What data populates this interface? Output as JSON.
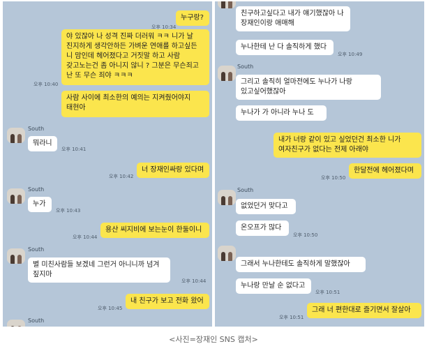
{
  "caption": "<사진=장재인 SNS 캡처>",
  "contact_name": "South",
  "colors": {
    "chat_background": "#b5c6d8",
    "my_bubble": "#fbe54d",
    "their_bubble": "#ffffff"
  },
  "left": {
    "messages": [
      {
        "from": "me",
        "text": "누구랑?",
        "time": "오후 10:34"
      },
      {
        "from": "me",
        "text": "야 있잖아 나 성격 진짜 더러워 ㅋㅋ 니가 날 진지하게 생각안하든 가벼운 연애를 하고싶든 니 맘인데 헤어졌다고 거짓말 하고 사람 갖고노는건 좀 아니지 않니 ? 그분은 무슨죄고 난 또 무슨 죄야 ㅋㅋㅋ",
        "time": "오후 10:40"
      },
      {
        "from": "me",
        "text": "사람 사이에 최소한의 예의는 지켜줬어야지 태현아",
        "time": ""
      },
      {
        "from": "them",
        "text": "뭐라니",
        "time": "오후 10:41"
      },
      {
        "from": "me",
        "text": "너 장재인싸랑 있다며",
        "time": "오후 10:42"
      },
      {
        "from": "them",
        "text": "누가",
        "time": "오후 10:43"
      },
      {
        "from": "me",
        "text": "용산 씨지비에 보는눈이 한둘이니",
        "time": "오후 10:44"
      },
      {
        "from": "them",
        "text": "별 미친사람들 보겠네 그런거 아니니까 넘겨 짚지마",
        "time": "오후 10:44"
      },
      {
        "from": "me",
        "text": "내 친구가 보고 전화 왔어",
        "time": "오후 10:45"
      }
    ]
  },
  "right": {
    "messages": [
      {
        "from": "them",
        "text": "친구하고싶다고 내가 얘기했잖아 나 장재인이랑 애매해",
        "time": ""
      },
      {
        "from": "them",
        "text": "누나한테 난 다 솔직하게 했다",
        "time": "오후 10:49"
      },
      {
        "from": "them",
        "text": "그리고 솔직히 얼마전에도 누나가 나랑 있고싶어했잖아",
        "time": ""
      },
      {
        "from": "them",
        "text": "누나가 가 아니라 누나 도",
        "time": ""
      },
      {
        "from": "me",
        "text": "내가 너랑 같이 있고 싶었던건 최소한 니가 여자친구가 없다는 전제 아래야",
        "time": ""
      },
      {
        "from": "me",
        "text": "한달전에 헤어졌다며",
        "time": "오후 10:50"
      },
      {
        "from": "them",
        "text": "없었던거 맞다고",
        "time": ""
      },
      {
        "from": "them",
        "text": "온오프가 많다",
        "time": "오후 10:50"
      },
      {
        "from": "them",
        "text": "그래서 누나한테도 솔직하게 말했잖아",
        "time": ""
      },
      {
        "from": "them",
        "text": "누나랑 만날 순 없다고",
        "time": "오후 10:51"
      },
      {
        "from": "me",
        "text": "그래 너 편한대로 즐기면서 잘살아",
        "time": "오후 10:51"
      }
    ]
  }
}
